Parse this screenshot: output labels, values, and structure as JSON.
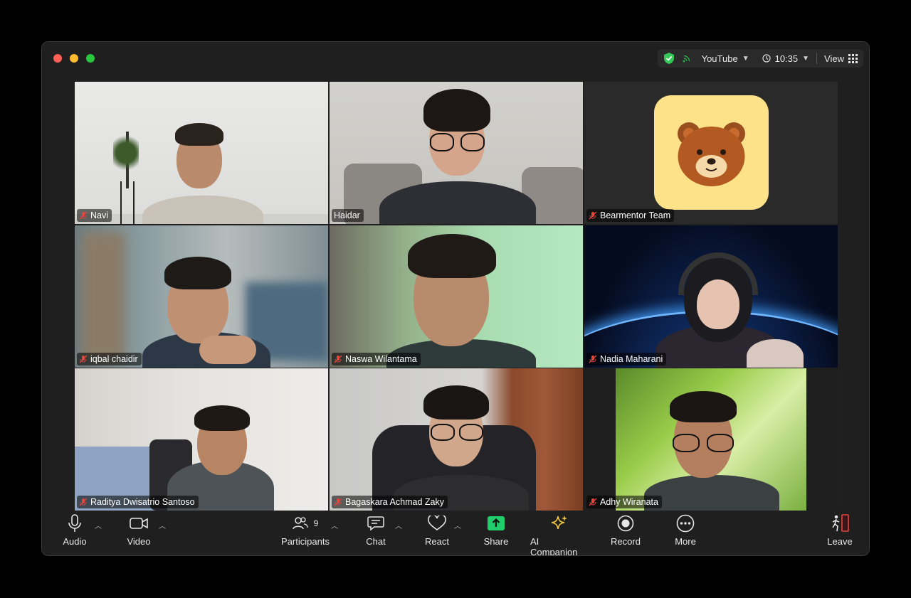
{
  "titlebar": {
    "stream_target": "YouTube",
    "time": "10:35",
    "view_label": "View"
  },
  "participants": [
    {
      "name": "Navi",
      "muted": true
    },
    {
      "name": "Haidar",
      "muted": false,
      "active_speaker": true
    },
    {
      "name": "Bearmentor Team",
      "muted": true
    },
    {
      "name": "iqbal chaidir",
      "muted": true
    },
    {
      "name": "Naswa Wilantama",
      "muted": true
    },
    {
      "name": "Nadia Maharani",
      "muted": true
    },
    {
      "name": "Raditya Dwisatrio Santoso",
      "muted": true
    },
    {
      "name": "Bagaskara Achmad Zaky",
      "muted": true
    },
    {
      "name": "Adhy Wiranata",
      "muted": true
    }
  ],
  "toolbar": {
    "audio": "Audio",
    "video": "Video",
    "participants": "Participants",
    "participant_count": "9",
    "chat": "Chat",
    "react": "React",
    "share": "Share",
    "ai_companion": "AI Companion",
    "record": "Record",
    "more": "More",
    "leave": "Leave"
  },
  "colors": {
    "active_speaker": "#3ac34d",
    "share_button": "#1fce6b",
    "ai_star": "#f5c842",
    "muted": "#e0463c",
    "shield": "#35c759"
  }
}
